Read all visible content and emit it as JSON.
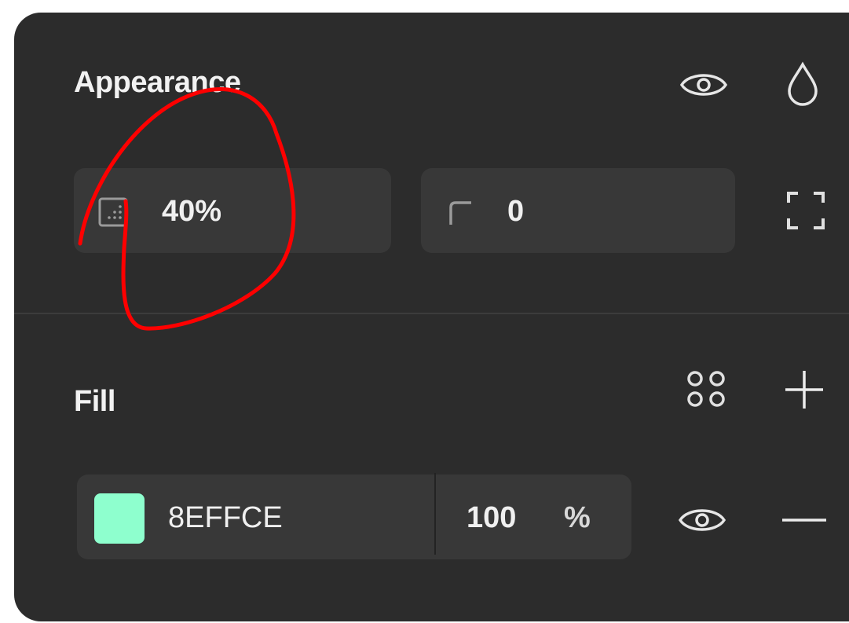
{
  "appearance": {
    "title": "Appearance",
    "opacity_value": "40%",
    "corner_radius_value": "0"
  },
  "fill": {
    "title": "Fill",
    "hex_value": "8EFFCE",
    "opacity_value": "100",
    "opacity_unit": "%"
  },
  "colors": {
    "panel_bg": "#2c2c2c",
    "field_bg": "#383838",
    "fill_swatch": "#8EFFCE",
    "annotation": "#ff0000"
  },
  "icons": {
    "appearance_visibility": "eye-icon",
    "appearance_blend": "drop-icon",
    "opacity": "opacity-icon",
    "corner_radius": "corner-radius-icon",
    "independent_corners": "independent-corners-icon",
    "fill_styles": "styles-grid-icon",
    "fill_add": "plus-icon",
    "fill_visibility": "eye-icon",
    "fill_remove": "minus-icon"
  }
}
